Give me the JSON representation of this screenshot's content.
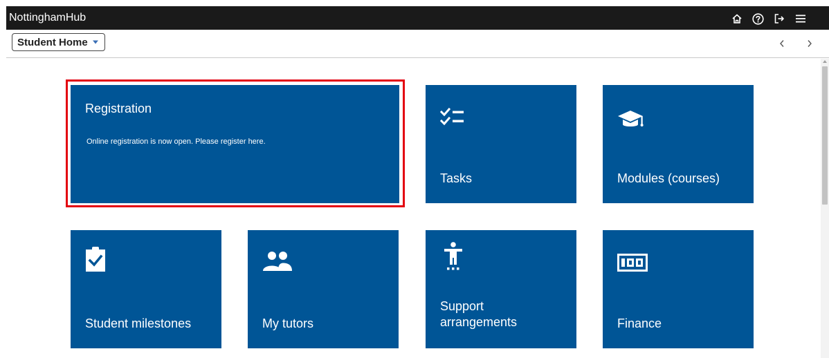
{
  "app": {
    "title": "NottinghamHub"
  },
  "topbar_icons": [
    "home-icon",
    "help-icon",
    "sign-out-icon",
    "menu-icon"
  ],
  "subbar": {
    "homepage_selector": "Student Home"
  },
  "tiles": {
    "registration": {
      "title": "Registration",
      "description": "Online registration is now open. Please register here."
    },
    "tasks": {
      "label": "Tasks",
      "icon": "checklist-icon"
    },
    "modules": {
      "label": "Modules (courses)",
      "icon": "graduation-cap-icon"
    },
    "milestones": {
      "label": "Student milestones",
      "icon": "clipboard-check-icon"
    },
    "tutors": {
      "label": "My tutors",
      "icon": "people-icon"
    },
    "support": {
      "label_line1": "Support",
      "label_line2": "arrangements",
      "icon": "accessibility-icon"
    },
    "finance": {
      "label": "Finance",
      "icon": "money-counter-icon"
    }
  },
  "colors": {
    "tile": "#005596",
    "topbar": "#1a1a1a",
    "highlight": "#e3000f"
  }
}
